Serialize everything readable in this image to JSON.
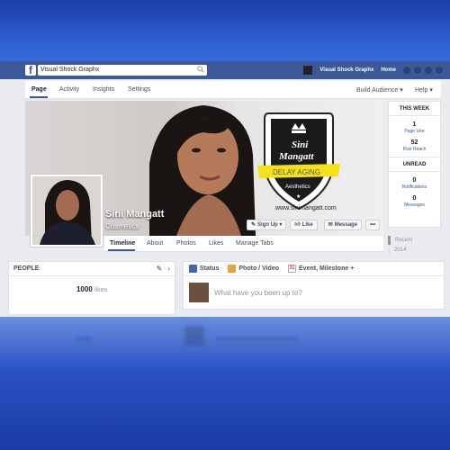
{
  "topbar": {
    "search_value": "Visual Shock Graphx",
    "user_name": "Visual Shock Graphx",
    "home_label": "Home"
  },
  "page_nav": {
    "items": [
      "Page",
      "Activity",
      "Insights",
      "Settings"
    ],
    "build_audience": "Build Audience ▾",
    "help": "Help ▾"
  },
  "cover": {
    "badge_line1": "Sini",
    "badge_line2": "Mangatt",
    "badge_ribbon": "DELAY AGING",
    "badge_sub": "Aesthetics",
    "url": "www.sinimangatt.com"
  },
  "profile": {
    "name": "Sini Mangatt",
    "category": "Cosmetics"
  },
  "cover_buttons": {
    "signup": "Sign Up ▾",
    "like": "Like",
    "message": "Message",
    "more": "•••"
  },
  "timeline_tabs": [
    "Timeline",
    "About",
    "Photos",
    "Likes",
    "Manage Tabs"
  ],
  "this_week": {
    "header": "THIS WEEK",
    "page_like_value": "1",
    "page_like_label": "Page Like",
    "post_reach_value": "52",
    "post_reach_label": "Post Reach",
    "unread_header": "UNREAD",
    "notifications_value": "0",
    "notifications_label": "Notifications",
    "messages_value": "0",
    "messages_label": "Messages"
  },
  "recent": {
    "item1": "Recent",
    "item2": "2014"
  },
  "people": {
    "header": "PEOPLE",
    "likes_count": "1000",
    "likes_label": "likes"
  },
  "composer": {
    "tab_status": "Status",
    "tab_photo": "Photo / Video",
    "tab_event": "Event, Milestone +",
    "placeholder": "What have you been up to?"
  },
  "colors": {
    "fb_blue": "#3b5998",
    "link": "#365899",
    "badge_yellow": "#f4e11a"
  }
}
